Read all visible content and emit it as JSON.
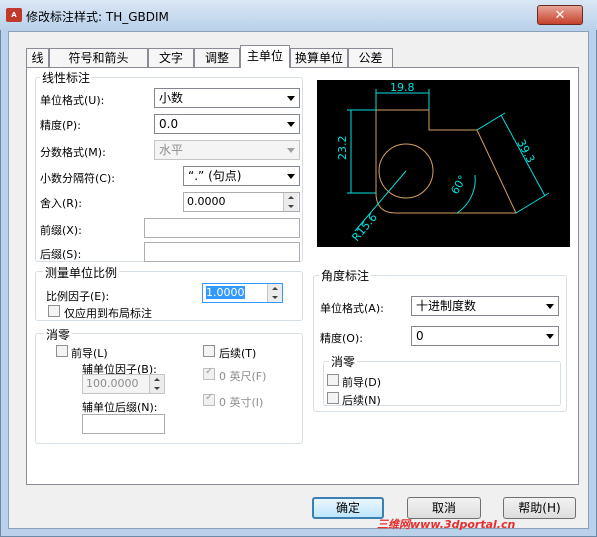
{
  "window": {
    "title": "修改标注样式: TH_GBDIM",
    "app_icon": "autocad-icon",
    "close_glyph": "✕"
  },
  "tabs": [
    {
      "label": "线"
    },
    {
      "label": "符号和箭头"
    },
    {
      "label": "文字"
    },
    {
      "label": "调整"
    },
    {
      "label": "主单位",
      "active": true
    },
    {
      "label": "换算单位"
    },
    {
      "label": "公差"
    }
  ],
  "linear": {
    "title": "线性标注",
    "unit_format": {
      "label": "单位格式(U):",
      "value": "小数"
    },
    "precision": {
      "label": "精度(P):",
      "value": "0.0"
    },
    "fraction_format": {
      "label": "分数格式(M):",
      "value": "水平"
    },
    "decimal_separator": {
      "label": "小数分隔符(C):",
      "value": "“.” (句点)"
    },
    "round_off": {
      "label": "舍入(R):",
      "value": "0.0000"
    },
    "prefix": {
      "label": "前缀(X):",
      "value": ""
    },
    "suffix": {
      "label": "后缀(S):",
      "value": ""
    }
  },
  "measurement_scale": {
    "title": "测量单位比例",
    "scale_factor": {
      "label": "比例因子(E):",
      "value": "1.0000"
    },
    "apply_layout": {
      "label": "仅应用到布局标注",
      "checked": false
    }
  },
  "zero_suppression": {
    "title": "消零",
    "leading": {
      "label": "前导(L)",
      "checked": false
    },
    "trailing": {
      "label": "后续(T)",
      "checked": false
    },
    "sub_unit_factor": {
      "label": "辅单位因子(B):",
      "value": "100.0000"
    },
    "sub_unit_suffix": {
      "label": "辅单位后缀(N):",
      "value": ""
    },
    "feet": {
      "label": "0 英尺(F)",
      "checked": true
    },
    "inches": {
      "label": "0 英寸(I)",
      "checked": true
    }
  },
  "preview": {
    "dims": [
      "19.8",
      "23.2",
      "39.3",
      "60°",
      "R15.6"
    ]
  },
  "angular": {
    "title": "角度标注",
    "unit_format": {
      "label": "单位格式(A):",
      "value": "十进制度数"
    },
    "precision": {
      "label": "精度(O):",
      "value": "0"
    },
    "zero_title": "消零",
    "leading": {
      "label": "前导(D)",
      "checked": false
    },
    "trailing": {
      "label": "后续(N)",
      "checked": false
    }
  },
  "buttons": {
    "ok": "确定",
    "cancel": "取消",
    "help": "帮助(H)"
  },
  "watermark": "三维网www.3dportal.cn",
  "colors": {
    "preview_bg": "#000000",
    "geometry": "#d4a060",
    "dimension": "#00e0e0",
    "highlight": "#3399ff"
  }
}
